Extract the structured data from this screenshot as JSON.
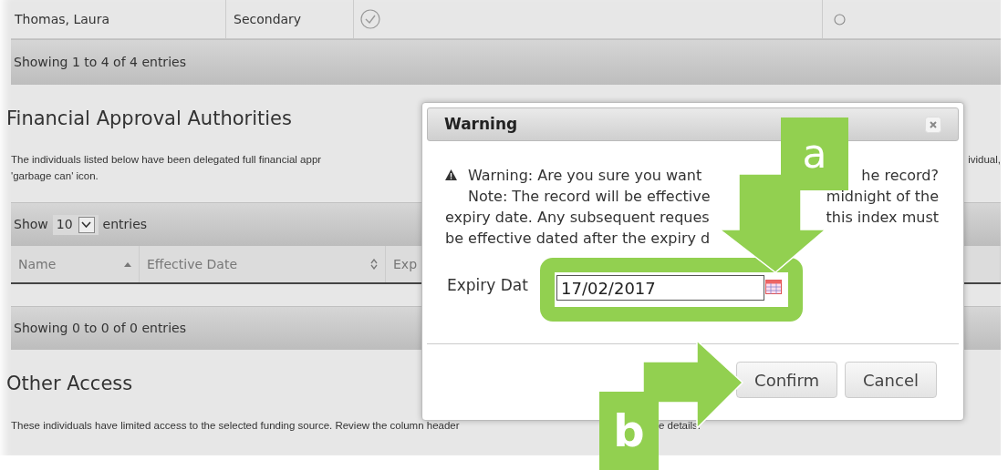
{
  "top_table": {
    "row": {
      "cells": [
        "Thomas, Laura",
        "Secondary"
      ],
      "checked": true,
      "radio_selected": false
    },
    "info": "Showing 1 to 4 of 4 entries"
  },
  "financial": {
    "heading": "Financial Approval Authorities",
    "description": "The individuals listed below have been delegated full financial appr",
    "description_right": "ividual,",
    "description_line2": "'garbage can' icon.",
    "length_menu": {
      "prefix": "Show",
      "value": "10",
      "suffix": "entries"
    },
    "columns": [
      {
        "label": "Name",
        "kind": "sorted"
      },
      {
        "label": "Effective Date",
        "kind": "sortable"
      },
      {
        "label": "Exp"
      }
    ],
    "info": "Showing 0 to 0 of 0 entries"
  },
  "other": {
    "heading": "Other Access",
    "description": "These individuals have limited access to the selected funding source. Review the column header",
    "description_tail": "e details."
  },
  "dialog": {
    "title": "Warning",
    "lines": [
      {
        "text": "Warning: Are you sure you want",
        "tail": "he record?",
        "indent": true,
        "icon": true
      },
      {
        "text": "Note: The record will be effective",
        "tail": "midnight of the",
        "indent": true,
        "icon": false
      },
      {
        "text": "expiry date. Any subsequent reques",
        "tail": "this index must",
        "indent": false,
        "icon": false
      },
      {
        "text": "be effective dated after the expiry d",
        "indent": false,
        "icon": false
      }
    ],
    "expiry": {
      "label": "Expiry Dat",
      "value": "17/02/2017"
    },
    "buttons": [
      "Confirm",
      "Cancel"
    ]
  },
  "annotations": [
    {
      "label": "a"
    },
    {
      "label": "b"
    }
  ]
}
